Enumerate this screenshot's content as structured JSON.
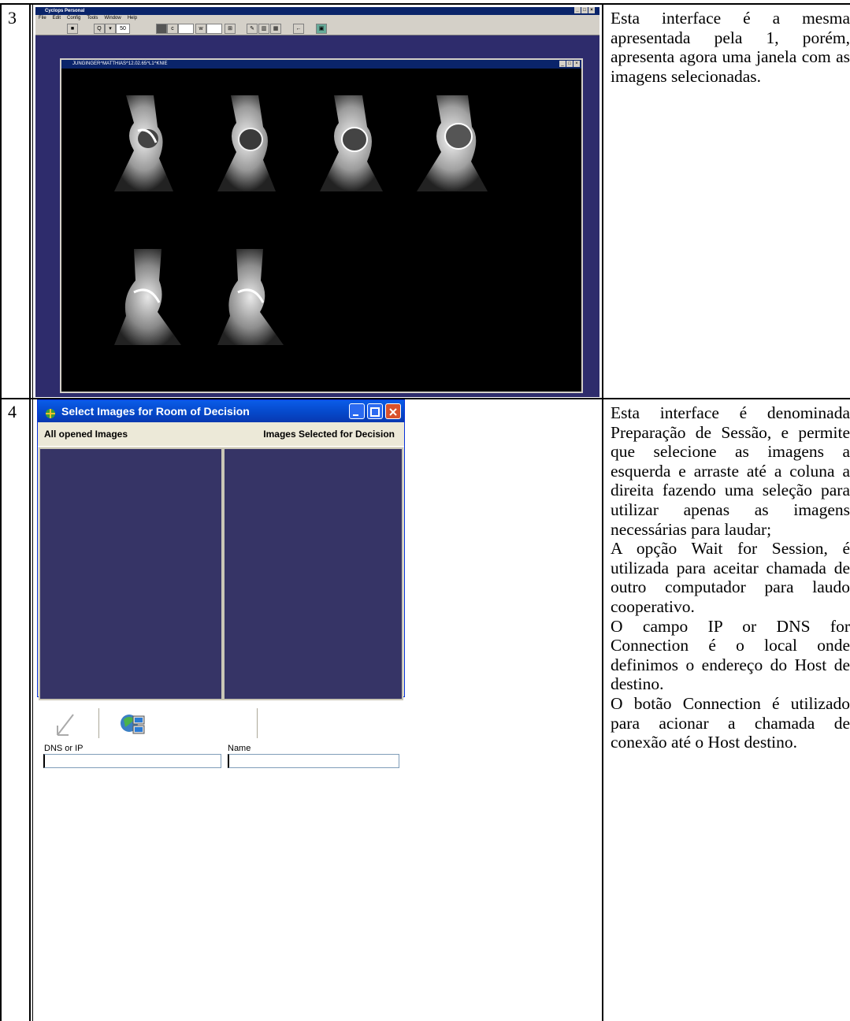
{
  "rows": [
    {
      "number": "3",
      "description": "Esta interface é a mesma apresentada pela 1, porém, apresenta agora uma janela com as imagens selecionadas."
    },
    {
      "number": "4",
      "description": "Esta interface é denominada Preparação de Sessão, e permite que selecione as imagens a esquerda e arraste até a coluna a direita fazendo uma seleção para utilizar apenas as imagens necessárias para laudar;\nA opção Wait for Session, é utilizada para aceitar chamada de outro computador para laudo cooperativo.\nO campo IP or DNS for Connection é o local onde definimos o endereço do Host de destino.\nO botão Connection é utilizado para acionar a chamada de conexão até o Host destino."
    }
  ],
  "cyclops": {
    "title": "Cyclops Personal",
    "menu": [
      "File",
      "Edit",
      "Config",
      "Tools",
      "Window",
      "Help"
    ],
    "zoom_value": "50",
    "child_title": "JUNGINGER^MATTHIAS^12.02.65^L1^KNIE"
  },
  "select_dialog": {
    "title": "Select Images for Room of Decision",
    "left_header": "All opened Images",
    "right_header": "Images Selected for Decision",
    "dns_label": "DNS or IP",
    "name_label": "Name",
    "dns_value": "",
    "name_value": ""
  }
}
